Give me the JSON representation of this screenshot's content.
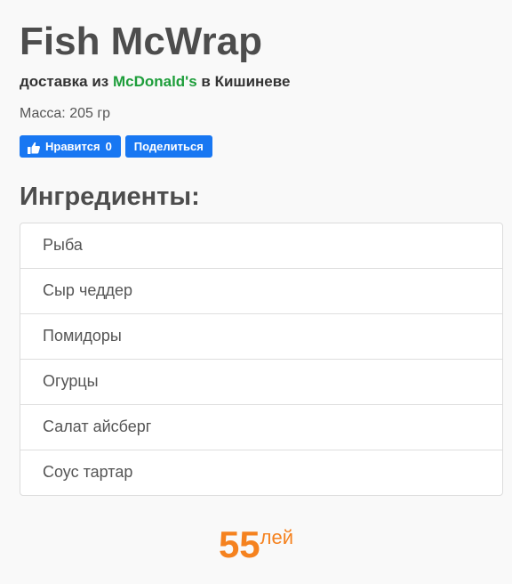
{
  "product": {
    "title": "Fish McWrap",
    "subtitle_prefix": "доставка из ",
    "brand": "McDonald's",
    "subtitle_suffix": " в Кишиневе",
    "mass": "Масса: 205 гр"
  },
  "social": {
    "like_label": "Нравится",
    "like_count": "0",
    "share_label": "Поделиться",
    "button_color": "#1877f2"
  },
  "ingredients": {
    "heading": "Ингредиенты:",
    "items": [
      "Рыба",
      "Сыр чеддер",
      "Помидоры",
      "Огурцы",
      "Салат айсберг",
      "Соус тартар"
    ]
  },
  "price": {
    "amount": "55",
    "currency": "лей",
    "color": "#f5821f"
  },
  "colors": {
    "brand_green": "#1e9e3b",
    "text": "#4a4a4a",
    "background": "#f9f9f9"
  }
}
